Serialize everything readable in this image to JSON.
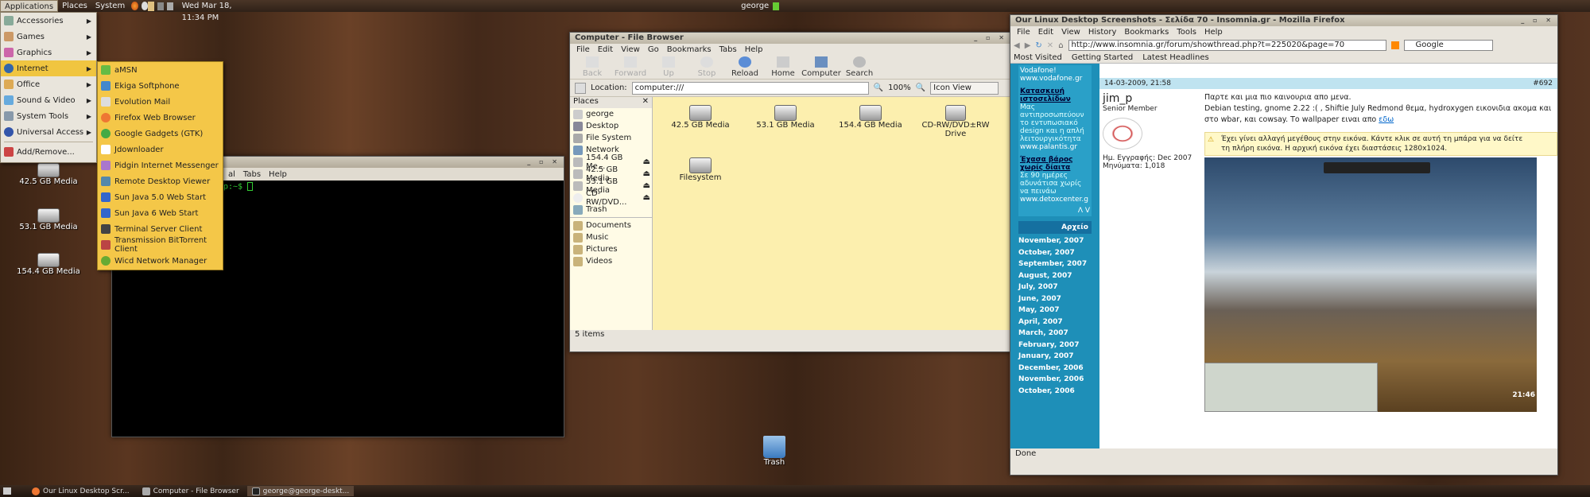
{
  "topbar": {
    "applications": "Applications",
    "places": "Places",
    "system": "System",
    "datetime": "Wed Mar 18, 11:34 PM",
    "user": "george"
  },
  "apps_menu": {
    "items": [
      "Accessories",
      "Games",
      "Graphics",
      "Internet",
      "Office",
      "Sound & Video",
      "System Tools",
      "Universal Access"
    ],
    "add_remove": "Add/Remove..."
  },
  "internet_menu": {
    "items": [
      "aMSN",
      "Ekiga Softphone",
      "Evolution Mail",
      "Firefox Web Browser",
      "Google Gadgets (GTK)",
      "Jdownloader",
      "Pidgin Internet Messenger",
      "Remote Desktop Viewer",
      "Sun Java 5.0 Web Start",
      "Sun Java 6 Web Start",
      "Terminal Server Client",
      "Transmission BitTorrent Client",
      "Wicd Network Manager"
    ]
  },
  "desktop": {
    "items": [
      "42.5 GB Media",
      "53.1 GB Media",
      "154.4 GB Media"
    ],
    "trash": "Trash"
  },
  "terminal": {
    "menu_tail": "al",
    "tabs": "Tabs",
    "help": "Help",
    "prompt": "p:~$"
  },
  "filebrowser": {
    "title": "Computer - File Browser",
    "menu": [
      "File",
      "Edit",
      "View",
      "Go",
      "Bookmarks",
      "Tabs",
      "Help"
    ],
    "toolbar": [
      "Back",
      "Forward",
      "Up",
      "Stop",
      "Reload",
      "Home",
      "Computer",
      "Search"
    ],
    "location_label": "Location:",
    "location": "computer:///",
    "zoom": "100%",
    "view_mode": "Icon View",
    "side_header": "Places",
    "side": [
      "george",
      "Desktop",
      "File System",
      "Network",
      "154.4 GB Me...",
      "42.5 GB Media",
      "53.1 GB Media",
      "CD-RW/DVD...",
      "Trash",
      "Documents",
      "Music",
      "Pictures",
      "Videos"
    ],
    "items": [
      "42.5 GB Media",
      "53.1 GB Media",
      "154.4 GB Media",
      "CD-RW/DVD±RW Drive",
      "Filesystem"
    ],
    "status": "5 items"
  },
  "firefox": {
    "title": "Our Linux Desktop Screenshots - Σελίδα 70 - Insomnia.gr - Mozilla Firefox",
    "menu": [
      "File",
      "Edit",
      "View",
      "History",
      "Bookmarks",
      "Tools",
      "Help"
    ],
    "url": "http://www.insomnia.gr/forum/showthread.php?t=225020&page=70",
    "search_placeholder": "Google",
    "bookmarks": [
      "Most Visited",
      "Getting Started",
      "Latest Headlines"
    ],
    "ad": {
      "l1": "Vodafone!",
      "l2": "www.vodafone.gr",
      "h1": "Κατασκευή ιστοσελίδων",
      "t1": "Μας αντιπροσωπεύουν το εντυπωσιακό design και η απλή λειτουργικότητα",
      "u1": "www.palantis.gr",
      "h2": "Έχασα βάρος χωρίς δίαιτα",
      "t2": "Σε 90 ημέρες αδυνάτισα χωρίς να πεινάω",
      "u2": "www.detoxcenter.g",
      "nav": "Λ V"
    },
    "archive_title": "Αρχείο",
    "archive": [
      "November, 2007",
      "October, 2007",
      "September, 2007",
      "August, 2007",
      "July, 2007",
      "June, 2007",
      "May, 2007",
      "April, 2007",
      "March, 2007",
      "February, 2007",
      "January, 2007",
      "December, 2006",
      "November, 2006",
      "October, 2006"
    ],
    "post": {
      "date": "14-03-2009, 21:58",
      "num": "#692",
      "user": "jim_p",
      "rank": "Senior Member",
      "reg": "Ημ. Εγγραφής: Dec 2007",
      "msgs": "Μηνύματα: 1,018",
      "l1": "Παρτε και μια πιο καινουρια απο μενα.",
      "l2": "Debian testing, gnome 2.22 :( , Shiftie July Redmond θεμα, hydroxygen εικονιδια ακομα και",
      "l3": "στο wbar, και cowsay. Το wallpaper ειναι απο",
      "link": "εδω",
      "notice1": "Έχει γίνει αλλαγή μεγέθους στην εικόνα. Κάντε κλικ σε αυτή τη μπάρα για να δείτε",
      "notice2": "τη πλήρη εικόνα. Η αρχική εικόνα έχει διαστάσεις 1280x1024.",
      "clock": "21:46"
    },
    "status": "Done"
  },
  "taskbar": [
    "Our Linux Desktop Scr...",
    "Computer - File Browser",
    "george@george-deskt..."
  ]
}
